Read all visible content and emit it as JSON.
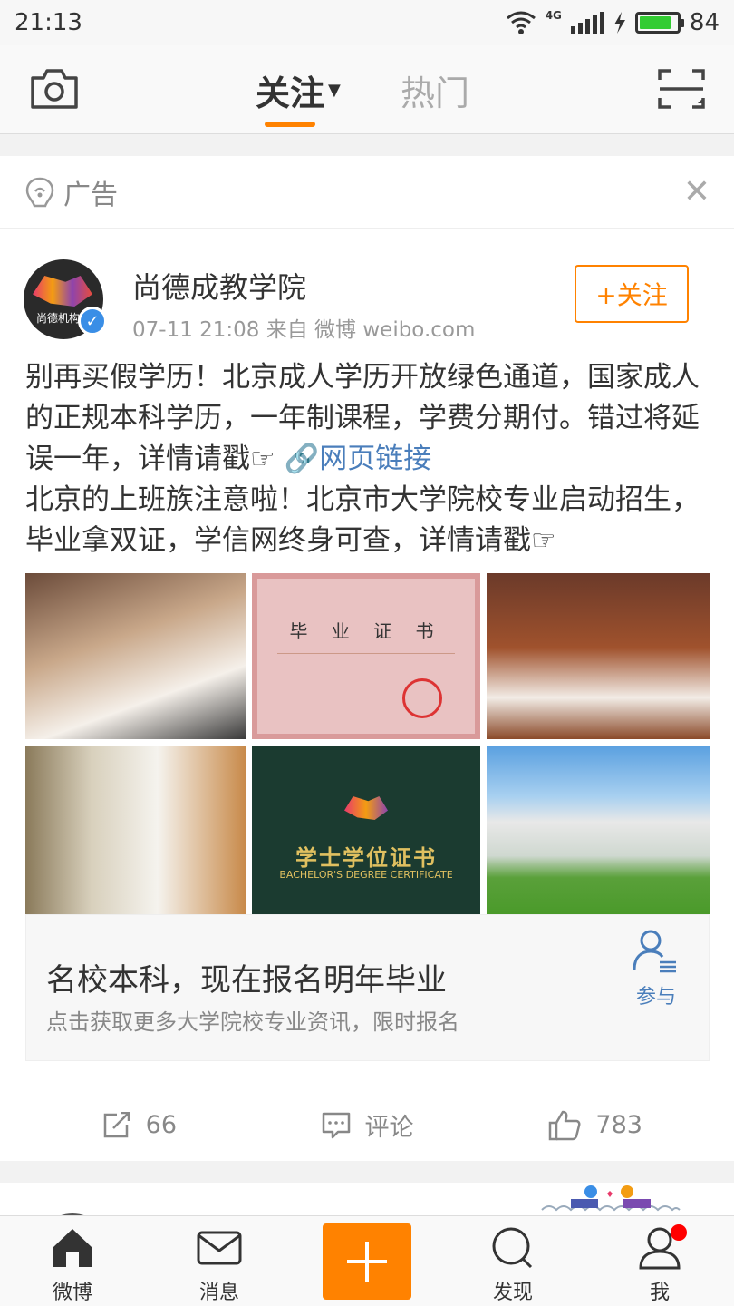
{
  "status_bar": {
    "time": "21:13",
    "network": "4G",
    "battery": "84",
    "battery_level": 0.84
  },
  "top_nav": {
    "tab_follow": "关注",
    "tab_hot": "热门"
  },
  "ad": {
    "label": "广告"
  },
  "post": {
    "user_name": "尚德成教学院",
    "meta": "07-11 21:08  来自 微博 weibo.com",
    "follow_label": "+关注",
    "avatar_text": "尚德机构",
    "text_p1": "别再买假学历！北京成人学历开放绿色通道，国家成人的正规本科学历，一年制课程，学费分期付。错过将延误一年，详情请戳☞",
    "link_text": "网页链接",
    "text_p2": "北京的上班族注意啦！北京市大学院校专业启动招生，毕业拿双证，学信网终身可查，详情请戳☞",
    "cert_title": "毕 业 证 书",
    "degree_title": "学士学位证书",
    "degree_sub": "BACHELOR'S DEGREE CERTIFICATE"
  },
  "promo": {
    "title": "名校本科，现在报名明年毕业",
    "subtitle": "点击获取更多大学院校专业资讯，限时报名",
    "join_label": "参与"
  },
  "actions": {
    "repost_count": "66",
    "comment_label": "评论",
    "like_count": "783"
  },
  "tabbar": {
    "home": "微博",
    "messages": "消息",
    "discover": "发现",
    "me": "我"
  }
}
